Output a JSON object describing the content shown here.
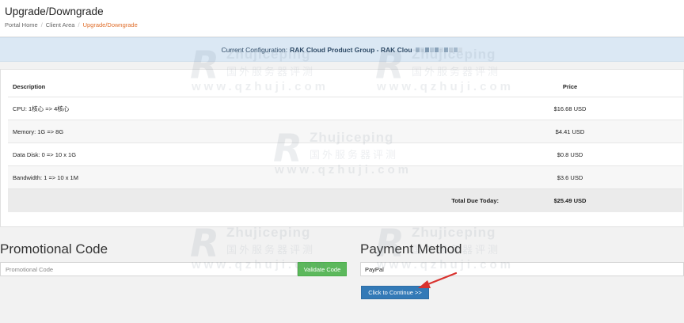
{
  "header": {
    "title": "Upgrade/Downgrade",
    "breadcrumb": [
      "Portal Home",
      "Client Area",
      "Upgrade/Downgrade"
    ]
  },
  "config": {
    "label": "Current Configuration:",
    "value": "RAK Cloud Product Group - RAK Clou"
  },
  "summary": {
    "columns": [
      "Description",
      "Price"
    ],
    "rows": [
      {
        "description": "CPU: 1核心 => 4核心",
        "price": "$16.68 USD"
      },
      {
        "description": "Memory: 1G => 8G",
        "price": "$4.41 USD"
      },
      {
        "description": "Data Disk: 0 => 10 x 1G",
        "price": "$0.8 USD"
      },
      {
        "description": "Bandwidth: 1 => 10 x 1M",
        "price": "$3.6 USD"
      }
    ],
    "total_label": "Total Due Today:",
    "total_value": "$25.49 USD"
  },
  "promo": {
    "title": "Promotional Code",
    "placeholder": "Promotional Code",
    "value": "",
    "button_label": "Validate Code"
  },
  "payment": {
    "title": "Payment Method",
    "selected": "PayPal",
    "continue_label": "Click to Continue >>"
  },
  "watermark": {
    "brand": "Zhujiceping",
    "sub": "国外服务器评测",
    "url": "www.qzhuji.com"
  },
  "colors": {
    "accent_orange": "#e06e2b",
    "config_bar": "#dbe8f4",
    "validate_green": "#5cb85c",
    "continue_blue": "#337ab7",
    "arrow_red": "#d9322e"
  }
}
